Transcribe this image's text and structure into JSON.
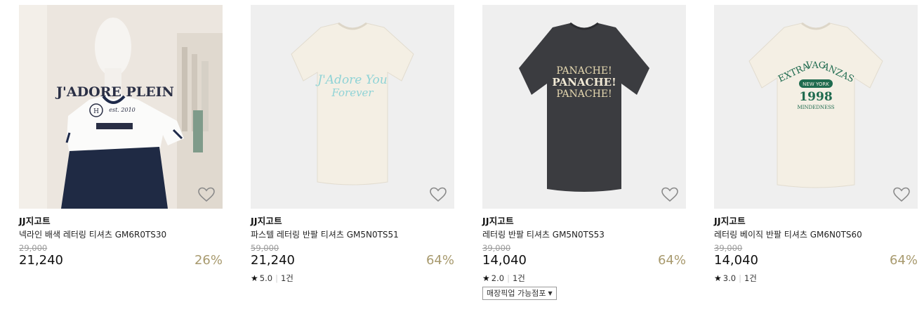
{
  "products": [
    {
      "brand": "JJ지고트",
      "name": "넥라인 배색 레터링 티셔츠 GM6R0TS30",
      "original_price": "29,000",
      "price": "21,240",
      "discount": "26%",
      "rating": "",
      "reviews": "",
      "shirt_text": [
        "J'ADORE PLEIN",
        "est. 2010"
      ]
    },
    {
      "brand": "JJ지고트",
      "name": "파스텔 레터링 반팔 티셔츠 GM5N0TS51",
      "original_price": "59,000",
      "price": "21,240",
      "discount": "64%",
      "rating": "5.0",
      "reviews": "1건",
      "shirt_text": [
        "J'Adore You",
        "Forever"
      ]
    },
    {
      "brand": "JJ지고트",
      "name": "레터링 반팔 티셔츠 GM5N0TS53",
      "original_price": "39,000",
      "price": "14,040",
      "discount": "64%",
      "rating": "2.0",
      "reviews": "1건",
      "store_button": "매장픽업 가능점포",
      "shirt_text": [
        "PANACHE!",
        "PANACHE!",
        "PANACHE!"
      ]
    },
    {
      "brand": "JJ지고트",
      "name": "레터링 베이직 반팔 티셔츠 GM6N0TS60",
      "original_price": "39,000",
      "price": "14,040",
      "discount": "64%",
      "rating": "3.0",
      "reviews": "1건",
      "shirt_text": [
        "EXTRA",
        "VAG",
        "ANZAS",
        "NEW YORK",
        "1998",
        "MINDEDNESS"
      ]
    }
  ],
  "icons": {
    "wishlist": "heart-outline-icon",
    "rating": "star-icon",
    "dropdown": "caret-down-icon"
  },
  "colors": {
    "discount": "#a89a6e",
    "strike_price": "#9a9a9a",
    "shirt_ivory": "#f4efe4",
    "shirt_charcoal": "#3b3c40",
    "print_mint": "#8fd3d6",
    "print_green": "#1f6b4f",
    "print_navy": "#1e2a4a"
  }
}
